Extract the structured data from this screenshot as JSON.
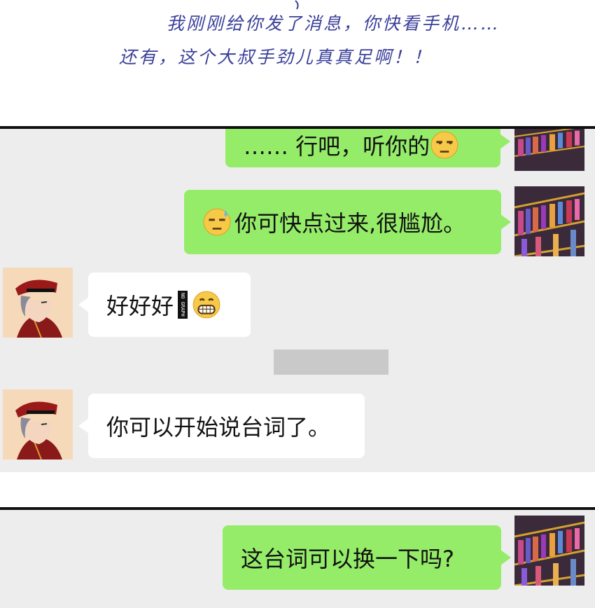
{
  "caption": {
    "line1": "我刚刚给你发了消息，你快看手机……",
    "line2": "还有，这个大叔手劲儿真真足啊！！"
  },
  "chat1": {
    "messages": [
      {
        "side": "right",
        "text": "…… 行吧，听你的",
        "emoji": "unamused-emoji"
      },
      {
        "side": "right",
        "text": "你可快点过来,很尴尬。",
        "emoji": "sweat-emoji"
      },
      {
        "side": "left",
        "text": "好好好",
        "watermark": "NO GRAPH",
        "emoji": "grin-emoji"
      },
      {
        "side": "left",
        "text": "你可以开始说台词了。"
      }
    ]
  },
  "chat2": {
    "messages": [
      {
        "side": "right",
        "text": "这台词可以换一下吗?"
      }
    ]
  },
  "colors": {
    "bubble_green": "#95ec69",
    "chat_bg": "#ededed",
    "caption_ink": "#3a3f9a"
  }
}
